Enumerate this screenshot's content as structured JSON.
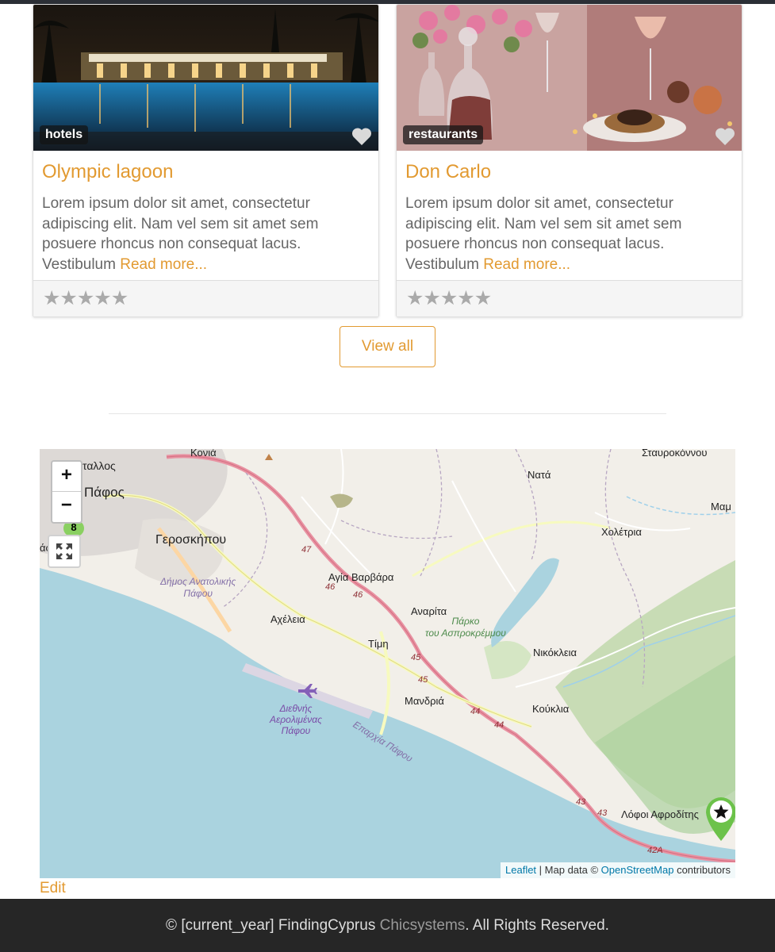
{
  "cards": [
    {
      "image_alt": "Hotel pool at night",
      "category": "hotels",
      "title": "Olympic lagoon",
      "description": "Lorem ipsum dolor sit amet, consectetur adipiscing elit. Nam vel sem sit amet sem posuere rhoncus non consequat lacus. Vestibulum ",
      "read_more": "Read more...",
      "rating_stars": [
        "★",
        "★",
        "★",
        "★",
        "★"
      ],
      "rating_value": 0
    },
    {
      "image_alt": "Restaurant table with decanters and glasses",
      "category": "restaurants",
      "title": "Don Carlo",
      "description": "Lorem ipsum dolor sit amet, consectetur adipiscing elit. Nam vel sem sit amet sem posuere rhoncus non consequat lacus. Vestibulum ",
      "read_more": "Read more...",
      "rating_stars": [
        "★",
        "★",
        "★",
        "★",
        "★"
      ],
      "rating_value": 0
    }
  ],
  "view_all_label": "View all",
  "map": {
    "zoom_in": "+",
    "zoom_out": "−",
    "cluster_count": "8",
    "labels": {
      "konia": "Κονιά",
      "stallos": "ταλλος",
      "pafos": "Πάφος",
      "fos": "άφος",
      "geroskipou": "Γεροσκήπου",
      "dimos": "Δήμος Ανατολικής\nΠάφου",
      "agia_varvara": "Αγία Βαρβάρα",
      "acheleia": "Αχέλεια",
      "anarita": "Αναρίτα",
      "timi": "Τίμη",
      "mandria": "Μανδριά",
      "nata": "Νατά",
      "choletria": "Χολέτρια",
      "nikokleia": "Νικόκλεια",
      "kouklia": "Κούκλια",
      "stavrokonnou": "Σταυροκόννου",
      "mam": "Μαμ",
      "parko": "Πάρκο\nτου Ασπροκρέμμου",
      "airport": "Διεθνής\nΑερολιμένας\nΠάφου",
      "eparchia": "Επαρχία Πάφου",
      "lofoi": "Λόφοι Αφροδίτης",
      "r47": "47",
      "r46a": "46",
      "r46b": "46",
      "r45a": "45",
      "r45b": "45",
      "r44a": "44",
      "r44b": "44",
      "r43a": "43",
      "r43b": "43",
      "r42a": "42A"
    },
    "attribution": {
      "leaflet": "Leaflet",
      "separator": " | Map data © ",
      "osm": "OpenStreetMap",
      "suffix": " contributors"
    }
  },
  "edit_label": "Edit",
  "footer": {
    "prefix": "© [current_year] FindingCyprus ",
    "link": "Chicsystems",
    "suffix": ". All Rights Reserved."
  },
  "colors": {
    "accent": "#e29a31",
    "footer_bg": "#262626",
    "sea": "#aad3df",
    "land": "#f2efe9",
    "forest": "#add19e",
    "motorway": "#e892a2"
  },
  "icons": [
    "heart-icon",
    "star-icon",
    "fullscreen-icon",
    "map-marker-icon"
  ]
}
